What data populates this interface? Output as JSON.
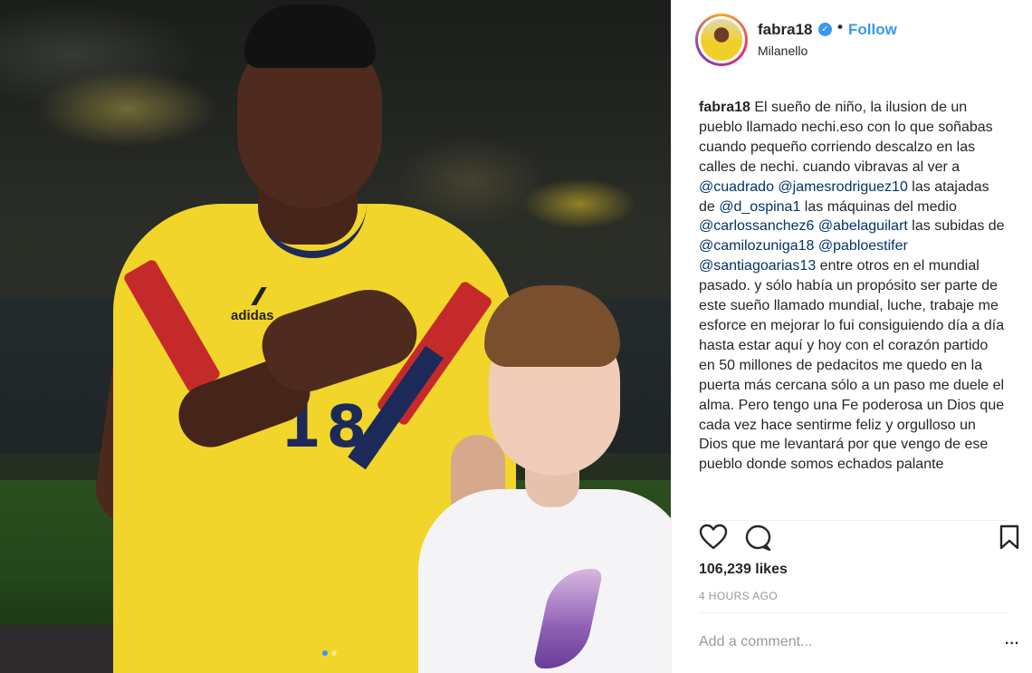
{
  "post": {
    "image_alt": "Player in yellow jersey number 18 with hand on chest, beside a boy in white t-shirt",
    "jersey_number": "18",
    "shirt_brand": "adidas",
    "carousel": {
      "count": 2,
      "active_index": 0
    }
  },
  "header": {
    "username": "fabra18",
    "verified_icon": "verified-check-icon",
    "separator": "•",
    "follow_label": "Follow",
    "location": "Milanello"
  },
  "caption": {
    "username": "fabra18",
    "parts": [
      " El sueño de niño, la ilusion de un pueblo llamado nechi.eso con lo que soñabas cuando pequeño corriendo descalzo en las calles de nechi. cuando vibravas al ver a ",
      "@cuadrado",
      " ",
      "@jamesrodriguez10",
      " las atajadas de ",
      "@d_ospina1",
      " las máquinas del medio ",
      "@carlossanchez6",
      " ",
      "@abelaguilart",
      " las subidas de ",
      "@camilozuniga18",
      " ",
      "@pabloestifer",
      " ",
      "@santiagoarias13",
      " entre otros en el mundial pasado. y sólo había un propósito ser parte de este sueño llamado mundial, luche, trabaje me esforce en mejorar lo fui consiguiendo día a día hasta estar aquí y hoy con el corazón partido en 50 millones de pedacitos me quedo en la puerta más cercana sólo a un paso me duele el alma. Pero tengo una Fe poderosa un Dios que cada vez hace sentirme feliz y orgulloso un Dios que me levantará por que vengo de ese pueblo donde somos echados palante"
    ]
  },
  "actions": {
    "like_icon": "heart-icon",
    "comment_icon": "comment-bubble-icon",
    "save_icon": "bookmark-icon",
    "likes_text": "106,239 likes",
    "time_text": "4 HOURS AGO"
  },
  "comment_box": {
    "placeholder": "Add a comment...",
    "more_label": "..."
  },
  "colors": {
    "accent": "#3897f0",
    "mention": "#003569",
    "text": "#262626",
    "muted": "#999999"
  }
}
